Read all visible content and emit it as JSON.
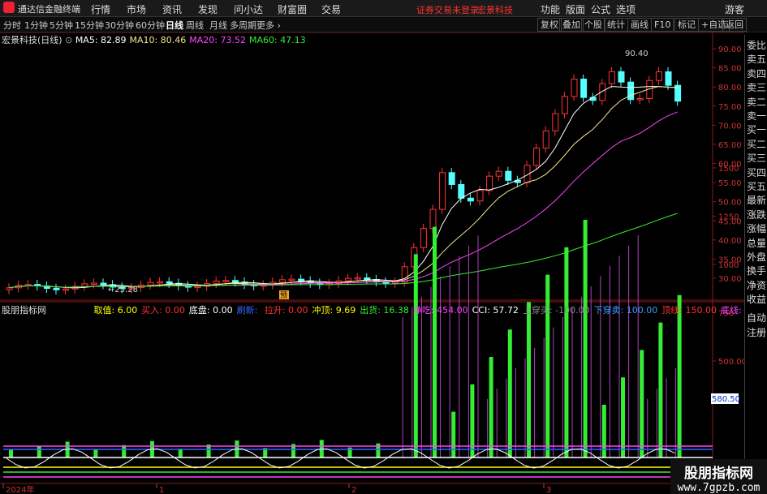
{
  "app": {
    "title": "通达信金融终端"
  },
  "menu": {
    "items": [
      "行情",
      "市场",
      "资讯",
      "发现",
      "问小达",
      "财富圈",
      "交易"
    ],
    "notice": "证券交易未登录",
    "stock_name": "宏景科技",
    "right_items": [
      "功能",
      "版面",
      "公式",
      "选项"
    ],
    "guest": "游客"
  },
  "toolbar": {
    "periods": [
      "分时",
      "1分钟",
      "5分钟",
      "15分钟",
      "30分钟",
      "60分钟",
      "日线",
      "周线",
      "月线",
      "多周期",
      "更多"
    ],
    "active": "日线",
    "right": [
      "复权",
      "叠加",
      "个股",
      "统计",
      "画线",
      "F10",
      "标记",
      "+自选",
      "返回"
    ]
  },
  "main_chart": {
    "title": "宏景科技(日线)",
    "ma": [
      {
        "label": "MA5: 82.89",
        "color": "#ffffff"
      },
      {
        "label": "MA10: 80.46",
        "color": "#f0e68c"
      },
      {
        "label": "MA20: 73.52",
        "color": "#ff44ff"
      },
      {
        "label": "MA60: 47.13",
        "color": "#33ee33"
      }
    ],
    "price_axis": [
      "90.00",
      "85.00",
      "80.00",
      "75.00",
      "70.00",
      "65.00",
      "60.00",
      "55.00",
      "50.00",
      "45.00",
      "40.00",
      "35.00",
      "30.00"
    ],
    "high_label": "90.40",
    "low_label": "25.28",
    "signal_label": "预"
  },
  "indicator": {
    "name": "股朋指标网",
    "values": [
      {
        "label": "取值: 6.00",
        "color": "#ffff00"
      },
      {
        "label": "买入: 0.00",
        "color": "#ff3333"
      },
      {
        "label": "底盘: 0.00",
        "color": "#ffffff"
      },
      {
        "label": "刷新: ",
        "color": "#3366ff"
      },
      {
        "label": "拉升: 0.00",
        "color": "#ff3333"
      },
      {
        "label": "冲顶: 9.69",
        "color": "#ffff00"
      },
      {
        "label": "出货: 16.38",
        "color": "#33ee33"
      },
      {
        "label": "净吃: 454.00",
        "color": "#ff44ff"
      },
      {
        "label": "CCI: 57.72",
        "color": "#ffffff"
      },
      {
        "label": "上穿买: -100.00",
        "color": "#888888"
      },
      {
        "label": "下穿卖: 100.00",
        "color": "#3399ff"
      },
      {
        "label": "顶线: 150.00",
        "color": "#ff3333"
      },
      {
        "label": "底线: -150.00",
        "color": "#ff44ff"
      }
    ],
    "axis": [
      "1500",
      "1250",
      "1000",
      "750",
      "500.00"
    ],
    "current": "580.50"
  },
  "sidebar": {
    "top": [
      "委比",
      "卖五",
      "卖四",
      "卖三",
      "卖二",
      "卖一",
      "买一",
      "买二",
      "买三",
      "买四",
      "买五",
      "最新",
      "涨跌",
      "涨幅",
      "总量",
      "外盘",
      "换手",
      "净资",
      "收益"
    ],
    "bottom": [
      "自动",
      "注册"
    ]
  },
  "time_axis": [
    "2024年",
    "1",
    "2",
    "3"
  ],
  "watermark": {
    "line1": "股朋指标网",
    "line2": "www.7gpzb.com"
  }
}
